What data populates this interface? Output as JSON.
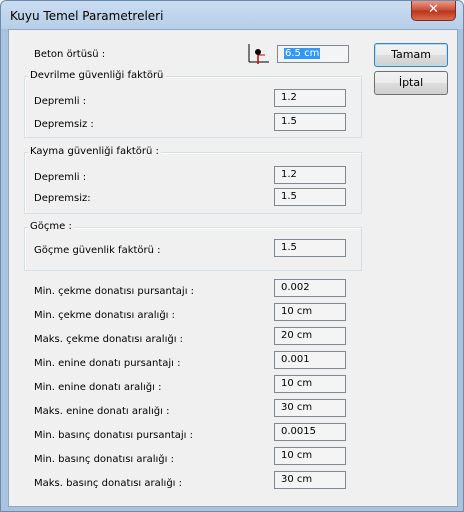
{
  "window": {
    "title": "Kuyu Temel Parametreleri",
    "close_glyph": "✕"
  },
  "buttons": {
    "ok": "Tamam",
    "cancel": "İptal"
  },
  "cover": {
    "label": "Beton örtüsü :",
    "value": "6.5 cm",
    "icon": "concrete-cover-icon"
  },
  "overturning": {
    "title": "Devrilme güvenliği faktörü",
    "rows": [
      {
        "label": "Depremli :",
        "value": "1.2"
      },
      {
        "label": "Depremsiz :",
        "value": "1.5"
      }
    ]
  },
  "sliding": {
    "title": "Kayma güvenliği faktörü :",
    "rows": [
      {
        "label": "Depremli :",
        "value": "1.2"
      },
      {
        "label": "Depremsiz:",
        "value": "1.5"
      }
    ]
  },
  "settlement": {
    "title": "Göçme :",
    "rows": [
      {
        "label": "Göçme güvenlik faktörü :",
        "value": "1.5"
      }
    ]
  },
  "rebar": [
    {
      "label": "Min. çekme donatısı pursantajı :",
      "value": "0.002"
    },
    {
      "label": "Min. çekme donatısı aralığı :",
      "value": "10 cm"
    },
    {
      "label": "Maks. çekme donatısı aralığı :",
      "value": "20 cm"
    },
    {
      "label": "Min. enine donatı pursantajı :",
      "value": "0.001"
    },
    {
      "label": "Min. enine donatı aralığı :",
      "value": "10 cm"
    },
    {
      "label": "Maks. enine donatı aralığı :",
      "value": "30 cm"
    },
    {
      "label": "Min. basınç donatısı pursantajı :",
      "value": "0.0015"
    },
    {
      "label": "Min. basınç donatısı aralığı :",
      "value": "10 cm"
    },
    {
      "label": "Maks. basınç donatısı aralığı :",
      "value": "30 cm"
    }
  ]
}
